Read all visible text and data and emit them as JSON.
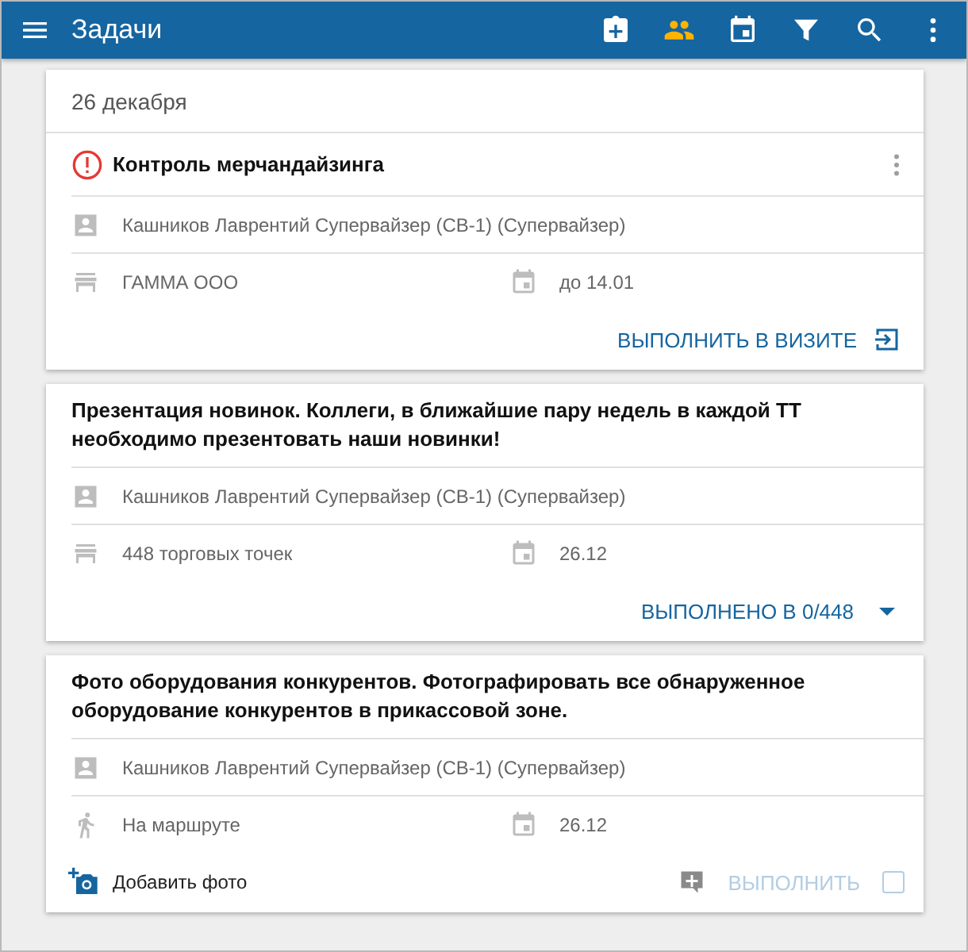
{
  "toolbar": {
    "title": "Задачи",
    "team_filter": {
      "on": true
    }
  },
  "date_header": "26 декабря",
  "tasks": [
    {
      "title": "Контроль мерчандайзинга",
      "urgent": true,
      "menu": true,
      "assignee": "Кашников Лаврентий Супервайзер (СВ-1) (Супервайзер)",
      "place": {
        "kind": "store",
        "text": "ГАММА ООО"
      },
      "due": "до 14.01",
      "action": {
        "kind": "visit",
        "label": "ВЫПОЛНИТЬ В ВИЗИТЕ"
      }
    },
    {
      "title": "Презентация новинок. Коллеги, в ближайшие пару недель в каждой ТТ необходимо презентовать наши новинки!",
      "urgent": false,
      "menu": false,
      "assignee": "Кашников Лаврентий Супервайзер (СВ-1) (Супервайзер)",
      "place": {
        "kind": "store",
        "text": "448 торговых точек"
      },
      "due": "26.12",
      "action": {
        "kind": "progress",
        "label": "ВЫПОЛНЕНО В 0/448",
        "expanded": false
      }
    },
    {
      "title": "Фото оборудования конкурентов. Фотографировать все обнаруженное оборудование конкурентов в прикассовой зоне.",
      "urgent": false,
      "menu": false,
      "assignee": "Кашников Лаврентий Супервайзер (СВ-1) (Супервайзер)",
      "place": {
        "kind": "route",
        "text": "На маршруте"
      },
      "due": "26.12",
      "action": {
        "kind": "complete",
        "photo_label": "Добавить фото",
        "label": "ВЫПОЛНИТЬ",
        "disabled": true,
        "checked": false
      }
    }
  ]
}
